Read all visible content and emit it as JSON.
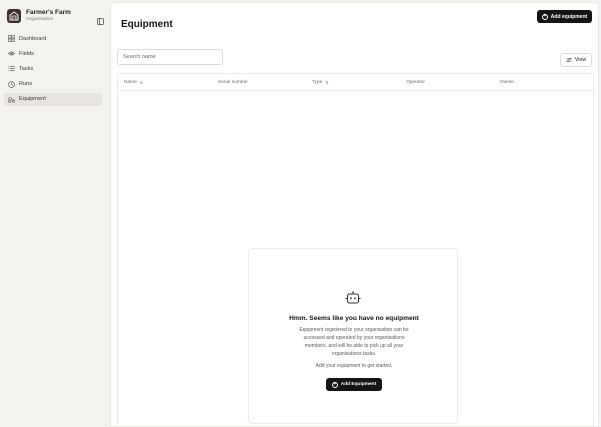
{
  "org": {
    "name": "Farmer's Farm",
    "subtitle": "Organisation"
  },
  "sidebar": {
    "items": [
      {
        "label": "Dashboard",
        "icon": "grid-icon",
        "active": false
      },
      {
        "label": "Fields",
        "icon": "eye-icon",
        "active": false
      },
      {
        "label": "Tasks",
        "icon": "list-icon",
        "active": false
      },
      {
        "label": "Runs",
        "icon": "clock-icon",
        "active": false
      },
      {
        "label": "Equipment",
        "icon": "tractor-icon",
        "active": true
      }
    ]
  },
  "header": {
    "title": "Equipment",
    "add_button": "Add equipment"
  },
  "toolbar": {
    "search_placeholder": "Search name",
    "view_button": "View"
  },
  "table": {
    "columns": [
      {
        "label": "Name",
        "sortable": true
      },
      {
        "label": "Serial number",
        "sortable": false
      },
      {
        "label": "Type",
        "sortable": true
      },
      {
        "label": "Operator",
        "sortable": false
      },
      {
        "label": "Owner",
        "sortable": false
      }
    ]
  },
  "empty_state": {
    "title": "Hmm. Seems like you have no equipment",
    "description": "Equipment registered to your organisation can be accessed and operated by your organisations members, and will be able to pick up all your organisations tasks.",
    "hint": "Add your equipment to get started.",
    "button": "Add Equipment",
    "icon": "robot-icon"
  }
}
